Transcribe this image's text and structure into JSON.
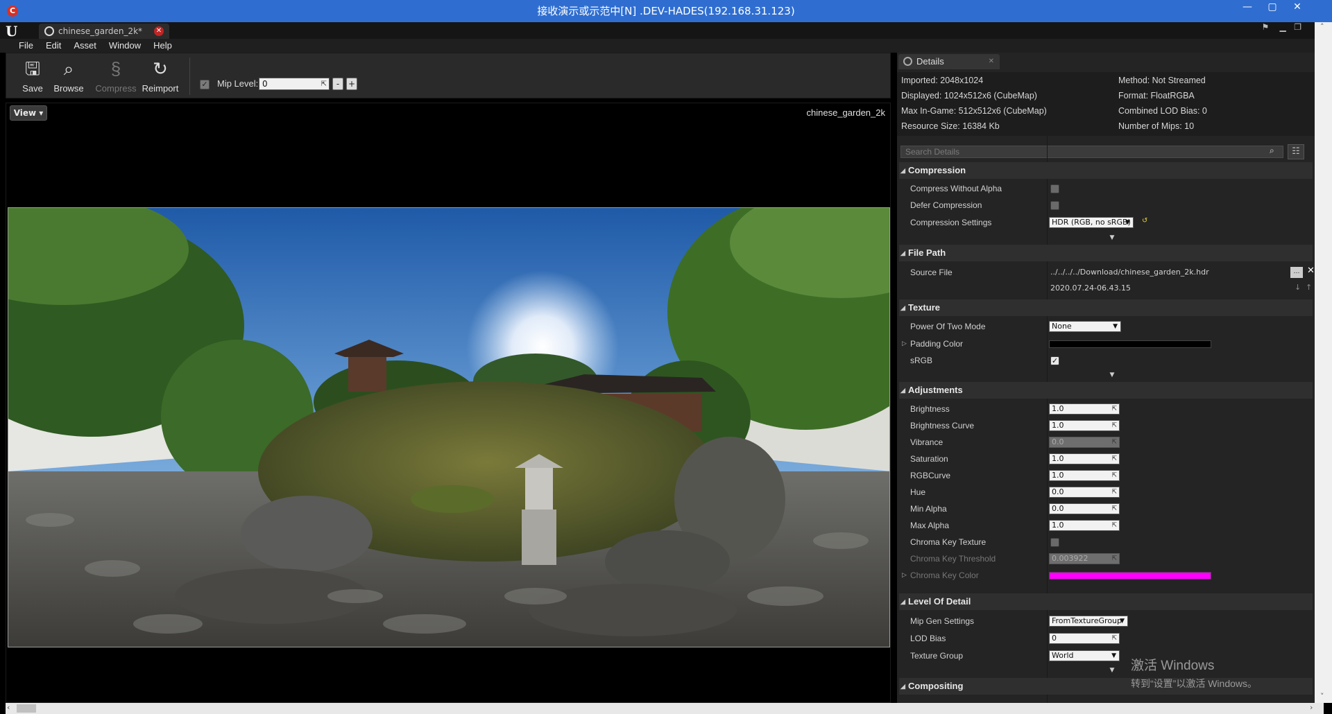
{
  "window": {
    "title": "接收演示或示范中[N] .DEV-HADES(192.168.31.123)"
  },
  "tab": {
    "label": "chinese_garden_2k*"
  },
  "menu": [
    "File",
    "Edit",
    "Asset",
    "Window",
    "Help"
  ],
  "toolbar": {
    "save": "Save",
    "browse": "Browse",
    "compress": "Compress",
    "reimport": "Reimport",
    "mip_label": "Mip Level:",
    "mip_value": "0",
    "minus": "-",
    "plus": "+"
  },
  "viewport": {
    "view_button": "View",
    "asset_name": "chinese_garden_2k"
  },
  "details": {
    "tab_label": "Details",
    "info": {
      "imported": "Imported: 2048x1024",
      "displayed": "Displayed: 1024x512x6 (CubeMap)",
      "max_in_game": "Max In-Game: 512x512x6 (CubeMap)",
      "resource_size": "Resource Size: 16384 Kb",
      "method": "Method: Not Streamed",
      "format": "Format: FloatRGBA",
      "lod_bias": "Combined LOD Bias: 0",
      "mips": "Number of Mips: 10"
    },
    "search_placeholder": "Search Details",
    "compression": {
      "title": "Compression",
      "compress_without_alpha": "Compress Without Alpha",
      "defer_compression": "Defer Compression",
      "compression_settings": "Compression Settings",
      "compression_settings_value": "HDR (RGB, no sRGB)"
    },
    "file_path": {
      "title": "File Path",
      "source_file": "Source File",
      "source_file_value": "../../../../Download/chinese_garden_2k.hdr",
      "timestamp": "2020.07.24-06.43.15"
    },
    "texture": {
      "title": "Texture",
      "power_of_two": "Power Of Two Mode",
      "power_of_two_value": "None",
      "padding_color": "Padding Color",
      "padding_color_hex": "#000000",
      "srgb": "sRGB"
    },
    "adjustments": {
      "title": "Adjustments",
      "brightness": "Brightness",
      "brightness_value": "1.0",
      "brightness_curve": "Brightness Curve",
      "brightness_curve_value": "1.0",
      "vibrance": "Vibrance",
      "vibrance_value": "0.0",
      "saturation": "Saturation",
      "saturation_value": "1.0",
      "rgbcurve": "RGBCurve",
      "rgbcurve_value": "1.0",
      "hue": "Hue",
      "hue_value": "0.0",
      "min_alpha": "Min Alpha",
      "min_alpha_value": "0.0",
      "max_alpha": "Max Alpha",
      "max_alpha_value": "1.0",
      "chroma_key_texture": "Chroma Key Texture",
      "chroma_key_threshold": "Chroma Key Threshold",
      "chroma_key_threshold_value": "0.003922",
      "chroma_key_color": "Chroma Key Color",
      "chroma_key_color_hex": "#ff00ff"
    },
    "lod": {
      "title": "Level Of Detail",
      "mip_gen": "Mip Gen Settings",
      "mip_gen_value": "FromTextureGroup",
      "lod_bias": "LOD Bias",
      "lod_bias_value": "0",
      "texture_group": "Texture Group",
      "texture_group_value": "World"
    },
    "compositing": {
      "title": "Compositing"
    }
  },
  "watermark": {
    "line1": "激活 Windows",
    "line2": "转到“设置”以激活 Windows。"
  },
  "colors": {
    "titlebar": "#2f6ed0",
    "panel": "#242424",
    "chroma": "#ff00ff"
  }
}
